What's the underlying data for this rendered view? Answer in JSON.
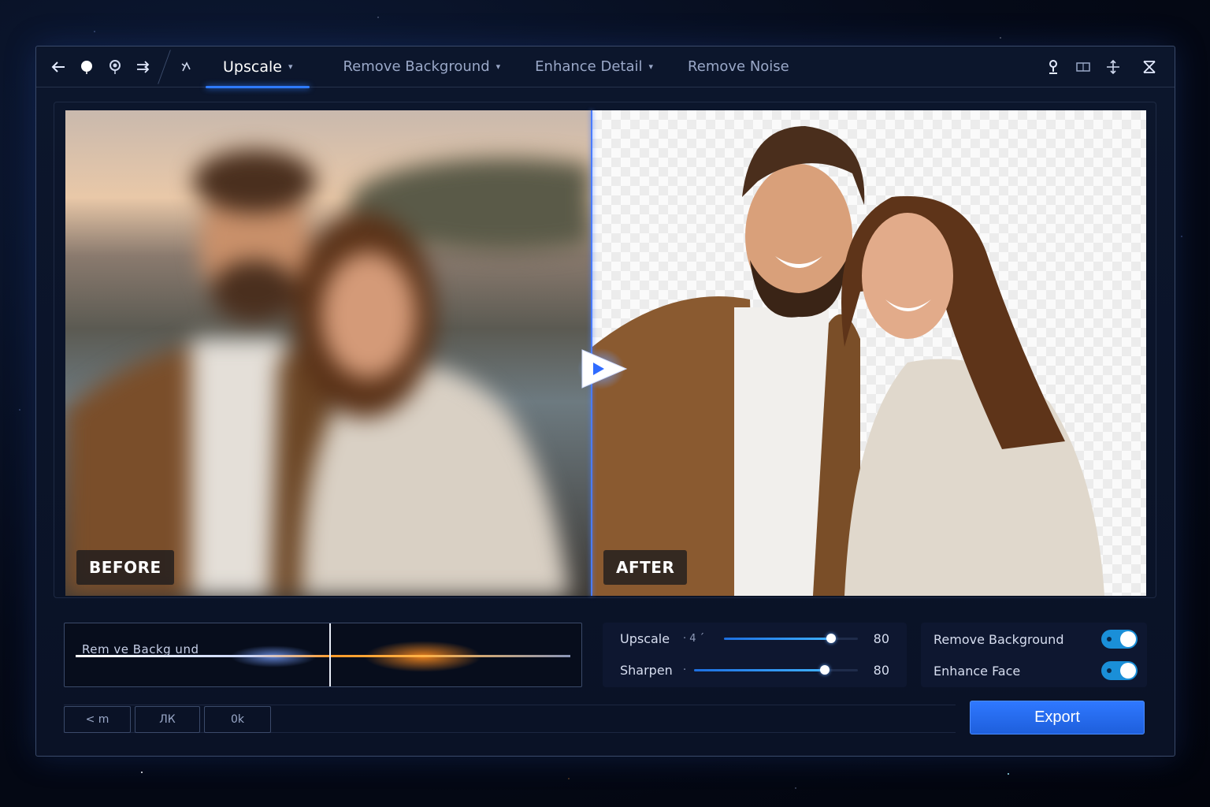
{
  "toolbar": {
    "left_icons": [
      "back-arrow-icon",
      "dot-icon",
      "balloon-icon",
      "redo-icon",
      "cursor-icon"
    ],
    "tabs": [
      {
        "label": "Upscale",
        "has_dropdown": true,
        "active": true
      },
      {
        "label": "Remove Background",
        "has_dropdown": true,
        "active": false
      },
      {
        "label": "Enhance Detail",
        "has_dropdown": true,
        "active": false
      },
      {
        "label": "Remove Noise",
        "has_dropdown": false,
        "active": false
      }
    ],
    "right_icons": [
      "pin-icon",
      "compare-icon",
      "move-icon",
      "close-icon"
    ]
  },
  "compare": {
    "before_label": "BEFORE",
    "after_label": "AFTER"
  },
  "timeline": {
    "text": "Rem  ve  Backg  und"
  },
  "sliders": [
    {
      "label": "Upscale",
      "extra": "· 4 ´",
      "value": "80",
      "level": 0.8
    },
    {
      "label": "Sharpen",
      "extra": "·",
      "value": "80",
      "level": 0.8
    }
  ],
  "toggles": [
    {
      "label": "Remove Background",
      "on": true
    },
    {
      "label": "Enhance Face",
      "on": true
    }
  ],
  "bottom_buttons": [
    {
      "label": "< m"
    },
    {
      "label": "ЛК"
    },
    {
      "label": "0k"
    }
  ],
  "export_label": "Export",
  "colors": {
    "accent": "#2f7bff",
    "toggle_on": "#1a8fd8",
    "background": "#0a1226"
  }
}
